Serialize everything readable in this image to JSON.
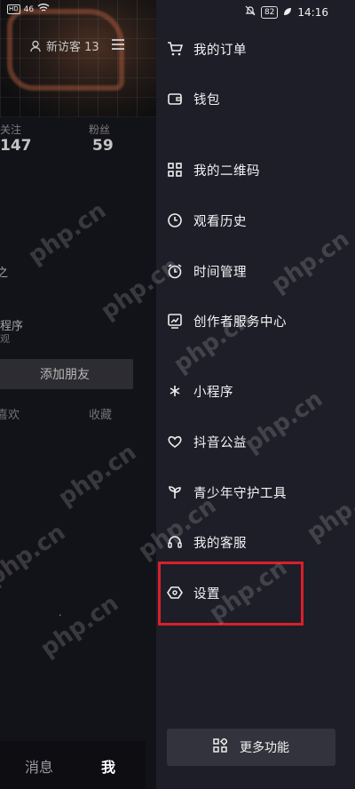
{
  "status_bar": {
    "left_tags": [
      "HD",
      "HD"
    ],
    "left_signal": "46",
    "battery": "82",
    "time": "14:16"
  },
  "profile": {
    "visitors_label": "新访客 13",
    "following_label": "关注",
    "following_count": "147",
    "followers_label": "粉丝",
    "followers_count": "59",
    "partial_line1": "之",
    "partial_program": "程序",
    "partial_view": "观",
    "add_friend": "添加朋友",
    "tab_likes": "喜欢",
    "tab_favorites": "收藏",
    "dot": "·"
  },
  "bottom_nav": {
    "messages": "消息",
    "me": "我"
  },
  "drawer": {
    "items": [
      {
        "label": "我的订单",
        "icon": "cart-icon"
      },
      {
        "label": "钱包",
        "icon": "wallet-icon"
      },
      {
        "label": "我的二维码",
        "icon": "qrcode-icon"
      },
      {
        "label": "观看历史",
        "icon": "clock-icon"
      },
      {
        "label": "时间管理",
        "icon": "alarm-icon"
      },
      {
        "label": "创作者服务中心",
        "icon": "chart-icon"
      },
      {
        "label": "小程序",
        "icon": "asterisk-icon"
      },
      {
        "label": "抖音公益",
        "icon": "heart-icon"
      },
      {
        "label": "青少年守护工具",
        "icon": "sprout-icon"
      },
      {
        "label": "我的客服",
        "icon": "headset-icon"
      },
      {
        "label": "设置",
        "icon": "hexagon-settings-icon"
      }
    ],
    "more_button": "更多功能"
  },
  "watermark": "php.cn",
  "colors": {
    "drawer_bg": "#1e1e28",
    "highlight_border": "#d8202a"
  }
}
